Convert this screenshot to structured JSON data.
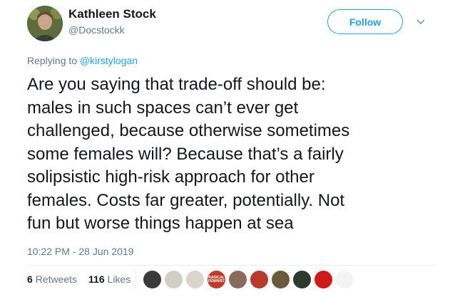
{
  "author": {
    "name": "Kathleen Stock",
    "handle": "@Docstockk"
  },
  "follow_label": "Follow",
  "replying": {
    "prefix": "Replying to ",
    "mention": "@kirstylogan"
  },
  "tweet_text": "Are you saying that trade-off should be:\nmales in such spaces can’t ever get\nchallenged, because otherwise sometimes\nsome females will? Because that’s a fairly\nsolipsistic high-risk approach for other\nfemales. Costs far greater, potentially. Not\nfun but worse things happen at sea",
  "timestamp": "10:22 PM - 28 Jun 2019",
  "stats": {
    "retweets_count": "6",
    "retweets_label": "Retweets",
    "likes_count": "116",
    "likes_label": "Likes"
  },
  "likers": [
    {
      "name": "liker-avatar-1",
      "color": "#3a3a3a"
    },
    {
      "name": "liker-avatar-2",
      "color": "#cfcfc4"
    },
    {
      "name": "liker-avatar-3",
      "color": "#d9d4cc"
    },
    {
      "name": "liker-avatar-4",
      "color": "#c0392b",
      "text": "RADICAL FEMINIST"
    },
    {
      "name": "liker-avatar-5",
      "color": "#8a6a5a"
    },
    {
      "name": "liker-avatar-6",
      "color": "#b83a2a"
    },
    {
      "name": "liker-avatar-7",
      "color": "#6a5a3a"
    },
    {
      "name": "liker-avatar-8",
      "color": "#2f3a2f"
    },
    {
      "name": "liker-avatar-9",
      "color": "#d01a1a"
    },
    {
      "name": "liker-avatar-10",
      "color": "#f4f4f4"
    }
  ],
  "colors": {
    "accent": "#1da1f2",
    "muted": "#657786",
    "text": "#14171a"
  }
}
